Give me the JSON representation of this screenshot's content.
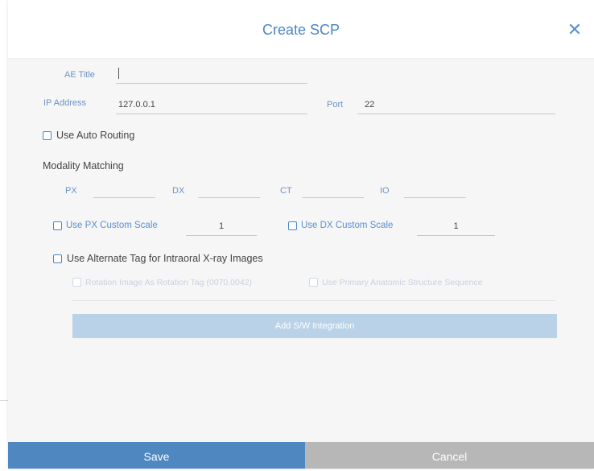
{
  "dialog": {
    "title": "Create SCP",
    "close_icon": "close-icon"
  },
  "form": {
    "ae_title": {
      "label": "AE Title",
      "value": ""
    },
    "ip_address": {
      "label": "IP Address",
      "value": "127.0.0.1"
    },
    "port": {
      "label": "Port",
      "value": "22"
    },
    "use_auto_routing": {
      "label": "Use Auto Routing",
      "checked": false
    },
    "modality_matching": {
      "heading": "Modality Matching",
      "fields": [
        {
          "label": "PX",
          "value": ""
        },
        {
          "label": "DX",
          "value": ""
        },
        {
          "label": "CT",
          "value": ""
        },
        {
          "label": "IO",
          "value": ""
        }
      ]
    },
    "px_custom_scale": {
      "label": "Use PX Custom Scale",
      "checked": false,
      "value": "1"
    },
    "dx_custom_scale": {
      "label": "Use DX Custom Scale",
      "checked": false,
      "value": "1"
    },
    "alternate_tag": {
      "label": "Use Alternate Tag for Intraoral X-ray Images",
      "checked": false
    },
    "rotation_tag": {
      "label": "Rotation Image As Rotation Tag (0070,0042)",
      "checked": false,
      "disabled": true
    },
    "primary_anatomic": {
      "label": "Use Primary Anatomic Structure Sequence",
      "checked": false,
      "disabled": true
    },
    "add_sw_integration": {
      "label": "Add S/W Integration",
      "disabled": true
    }
  },
  "footer": {
    "save_label": "Save",
    "cancel_label": "Cancel"
  },
  "colors": {
    "accent": "#4a86c5",
    "save_bg": "#4f87c0",
    "cancel_bg": "#b7b7b7"
  }
}
